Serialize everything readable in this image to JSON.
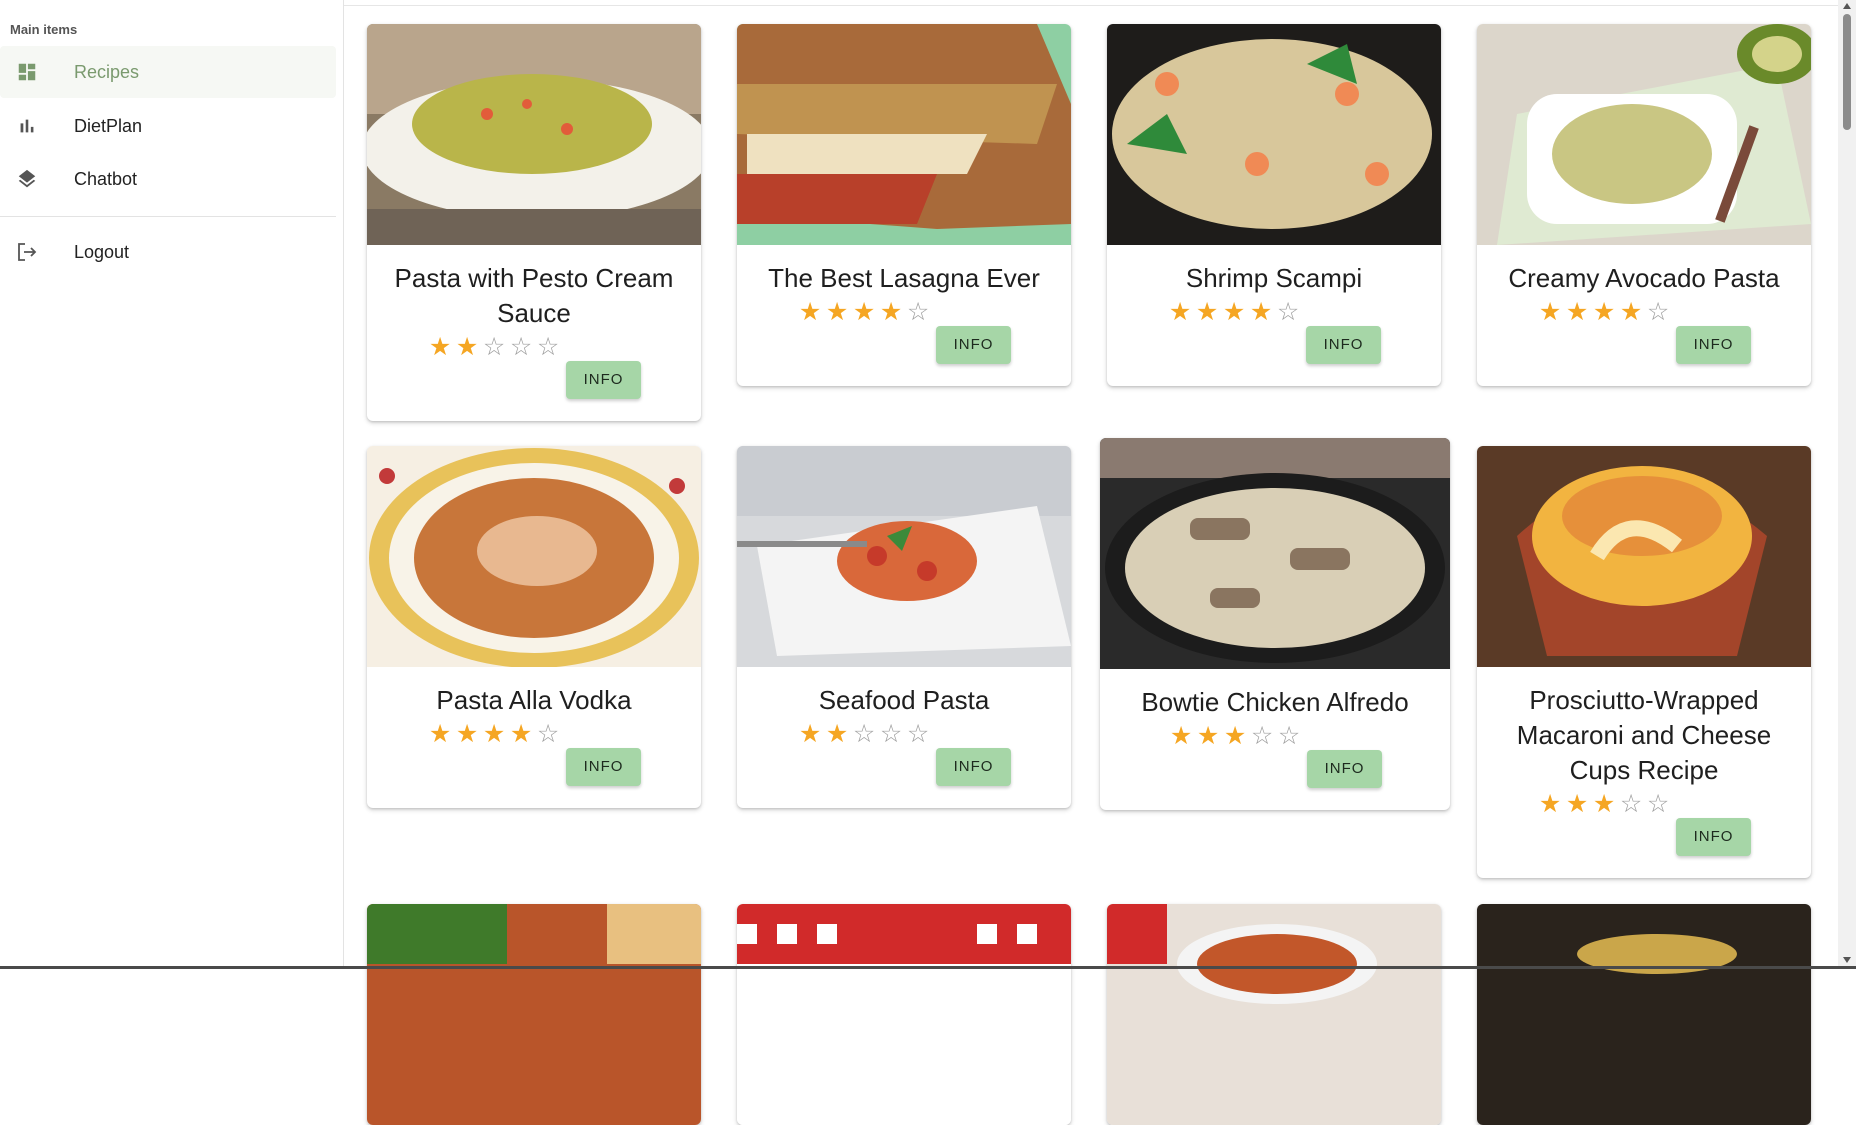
{
  "sidebar": {
    "section_title": "Main items",
    "items": [
      {
        "label": "Recipes",
        "icon": "dashboard-icon",
        "active": true
      },
      {
        "label": "DietPlan",
        "icon": "bar-chart-icon",
        "active": false
      },
      {
        "label": "Chatbot",
        "icon": "layers-icon",
        "active": false
      }
    ],
    "logout_label": "Logout"
  },
  "colors": {
    "accent_green": "#a6d6a7",
    "active_text": "#7a9a6e",
    "star": "#f5a623"
  },
  "recipes": [
    {
      "title": "Pasta with Pesto Cream Sauce",
      "rating": 2,
      "button": "INFO"
    },
    {
      "title": "The Best Lasagna Ever",
      "rating": 4,
      "button": "INFO"
    },
    {
      "title": "Shrimp Scampi",
      "rating": 4,
      "button": "INFO"
    },
    {
      "title": "Creamy Avocado Pasta",
      "rating": 4,
      "button": "INFO"
    },
    {
      "title": "Pasta Alla Vodka",
      "rating": 4,
      "button": "INFO"
    },
    {
      "title": "Seafood Pasta",
      "rating": 2,
      "button": "INFO"
    },
    {
      "title": "Bowtie Chicken Alfredo",
      "rating": 3,
      "button": "INFO"
    },
    {
      "title": "Prosciutto-Wrapped Macaroni and Cheese Cups Recipe",
      "rating": 3,
      "button": "INFO"
    }
  ]
}
